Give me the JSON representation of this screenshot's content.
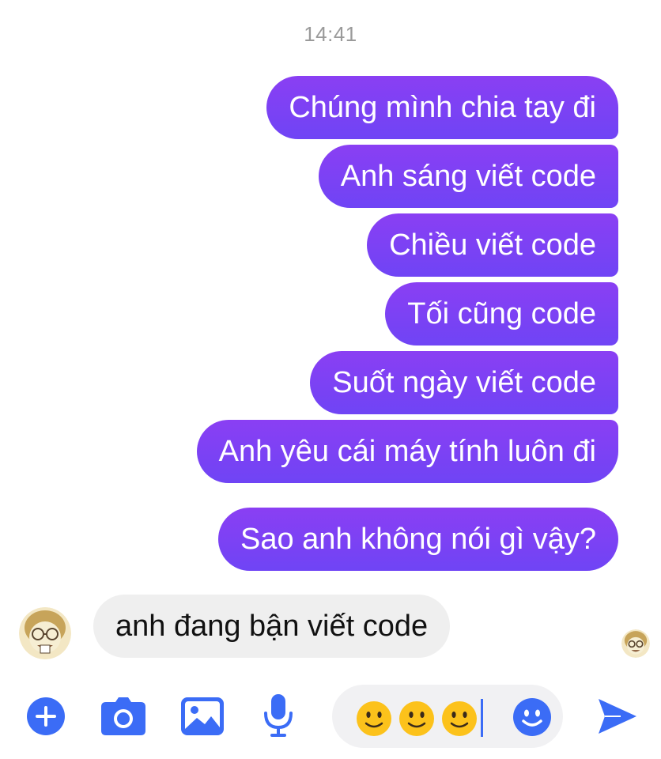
{
  "timestamp": "14:41",
  "outgoing_messages": [
    "Chúng mình chia tay đi",
    "Anh sáng viết code",
    "Chiều viết code",
    "Tối cũng code",
    "Suốt ngày viết code",
    "Anh yêu cái máy tính luôn đi",
    "Sao anh không nói gì vậy?"
  ],
  "incoming_message": "anh đang bận viết code",
  "composer": {
    "value": "🙂🙂🙂"
  },
  "icons": {
    "add": "plus-circle-icon",
    "camera": "camera-icon",
    "gallery": "image-icon",
    "voice": "microphone-icon",
    "emoji": "smiley-icon",
    "send": "send-arrow-icon"
  },
  "colors": {
    "outgoing_bubble": "#7B3CF2",
    "incoming_bubble": "#EFEFEF",
    "accent": "#3B6CF6",
    "timestamp": "#9A9A9A"
  }
}
